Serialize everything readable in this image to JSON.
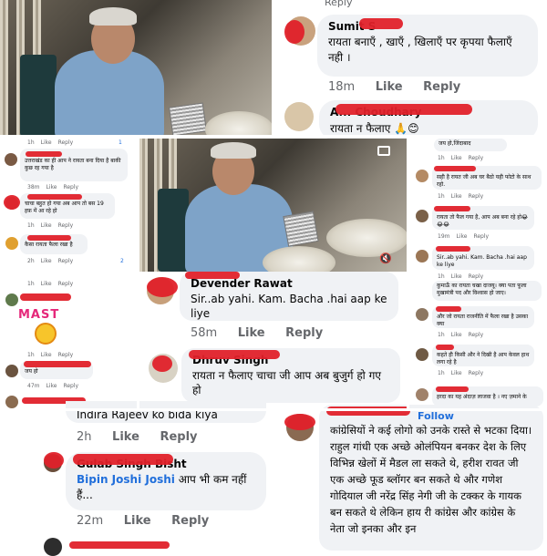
{
  "top_right": {
    "comment1": {
      "name": "Sumit S",
      "text": "रायता बनाएँ , खाएँ , खिलाएँ पर कृपया फैलाएँ नही ।",
      "time": "18m",
      "like": "Like",
      "reply": "Reply",
      "top_faded": "Reply"
    },
    "comment2": {
      "name": "A... Choudhary",
      "text": "रायता न फैलाए 🙏😊"
    }
  },
  "center": {
    "comment1": {
      "name": "Devender Rawat",
      "text": "Sir..ab yahi. Kam. Bacha .hai aap ke liye",
      "time": "58m",
      "like": "Like",
      "reply": "Reply"
    },
    "comment2": {
      "name": "Dhruv Singh",
      "text": "रायता न फैलाए चाचा जी आप अब बुजुर्ग हो गए हो"
    }
  },
  "left_column": {
    "top_actions": {
      "time": "1h",
      "like": "Like",
      "reply": "Reply",
      "count": "1"
    },
    "c1": {
      "text": "उत्तराखंड का ही आप ने रायता बना दिया है बाकी कुछ रह गया है",
      "time": "38m",
      "like": "Like",
      "reply": "Reply"
    },
    "c2": {
      "text": "चाचा बहुत हो गया अब आप तो बस 19 हफ़ में आ रहे हो",
      "time": "1h",
      "like": "Like",
      "reply": "Reply"
    },
    "c3": {
      "text": "कैसा रायता फैला रखा है",
      "time": "2h",
      "like": "Like",
      "reply": "Reply",
      "count": "2"
    },
    "c4": {
      "time": "1h",
      "like": "Like",
      "reply": "Reply"
    },
    "mast": "MAST",
    "c5": {
      "time": "1h",
      "like": "Like",
      "reply": "Reply"
    },
    "c6": {
      "text": "जय हो",
      "time": "47m",
      "like": "Like",
      "reply": "Reply"
    }
  },
  "right_column": {
    "c0": {
      "text": "जय हो,जिंदाबाद",
      "time": "1h",
      "like": "Like",
      "reply": "Reply"
    },
    "c1": {
      "text": "सही है रायत जी अब घर बैठो यही फोटो के साथ रहो.",
      "time": "1h",
      "like": "Like",
      "reply": "Reply"
    },
    "c2": {
      "text": "रायता तो फैल गया है, आप अब बना रहे हो😂😂😂",
      "time": "19m",
      "like": "Like",
      "reply": "Reply"
    },
    "c3": {
      "text": "Sir..ab yahi. Kam. Bacha .hai aap ke liye",
      "time": "1h",
      "like": "Like",
      "reply": "Reply"
    },
    "c3b": {
      "text": "कुमाऊँ का रायता चखा दाजयू। क्या पता फूला मुखामंत्री पद और विश्वास हो जाए।"
    },
    "c4": {
      "text": "और जो रायता राजनीति में फैला रखा है उसका क्या",
      "time": "1h",
      "like": "Like",
      "reply": "Reply"
    },
    "c5": {
      "text": "कहते ही किसी और ने दिखी है आप केवल हाथ लगा रहे है",
      "time": "1h",
      "like": "Like",
      "reply": "Reply"
    },
    "c6": {
      "text": "हरदा का यह अंदाज़ लाजवा है । नए ज़माने के"
    }
  },
  "bottom_left": {
    "c0": {
      "text": "Indira Rajeev ko bida kiya",
      "time": "2h",
      "like": "Like",
      "reply": "Reply"
    },
    "c1": {
      "name": "Gulab Singh Bisht",
      "tag": "Bipin Joshi Joshi",
      "text": "आप भी कम नहीं हैं...",
      "time": "22m",
      "like": "Like",
      "reply": "Reply"
    }
  },
  "bottom_right": {
    "follow": "Follow",
    "text": "कांग्रेसियों ने कई लोगो को उनके रास्ते से भटका दिया। राहुल गांधी एक अच्छे ओलंपियन बनकर देश के लिए विभिन्न खेलों में मैडल ला सकते थे, हरीश रावत जी एक अच्छे फूड ब्लॉगर बन सकते थे और गणेश गोदियाल जी नरेंद्र सिंह नेगी जी के टक्कर के गायक बन सकते थे लेकिन हाय री कांग्रेस और कांग्रेस के नेता जो इनका और इन"
  },
  "colors": {
    "redact": "#e0212a",
    "bubble": "#f0f2f5",
    "meta": "#65676b",
    "link": "#216fdb"
  }
}
